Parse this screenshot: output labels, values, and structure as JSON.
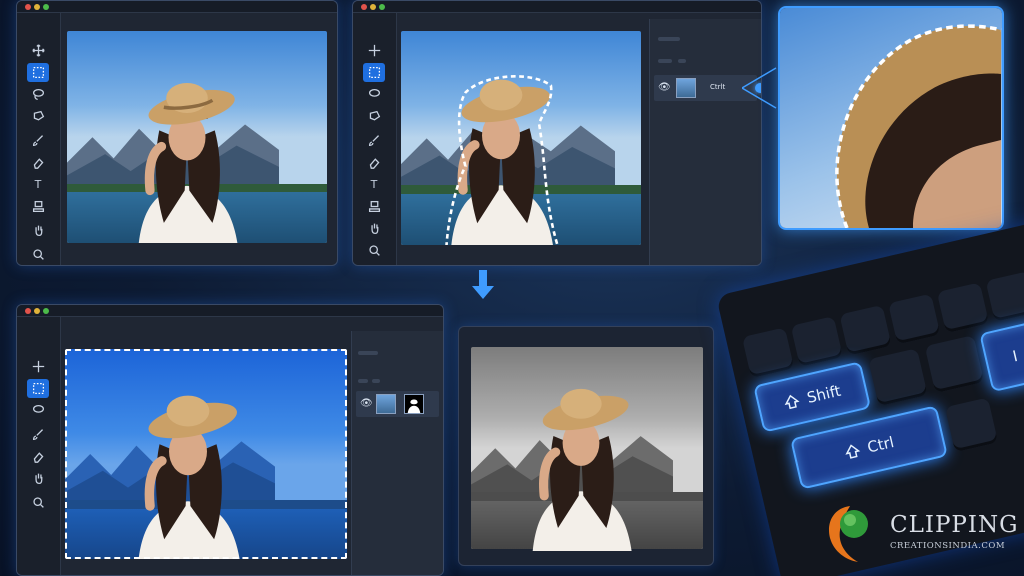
{
  "windows": {
    "w1": {
      "tools": [
        "move-icon",
        "marquee-icon",
        "lasso-icon",
        "polygon-lasso-icon",
        "brush-icon",
        "eraser-icon",
        "text-icon",
        "stamp-icon",
        "hand-icon",
        "zoom-icon"
      ],
      "tools_text": {
        "text-icon": "T"
      }
    },
    "w2": {
      "layer": {
        "name": "Ctrlt",
        "eye": "👁"
      }
    },
    "w3": {
      "layer": {
        "name": "",
        "eye": "👁"
      }
    }
  },
  "keyboard": {
    "shift_label": "Shift",
    "ctrl_label": "Ctrl",
    "i_label": "I"
  },
  "logo": {
    "title": "CLIPPING",
    "subtitle": "CREATIONSINDIA.COM"
  },
  "colors": {
    "accent": "#1f6fe0",
    "glow": "#4fa5ff",
    "window_bg": "#1f2633"
  }
}
